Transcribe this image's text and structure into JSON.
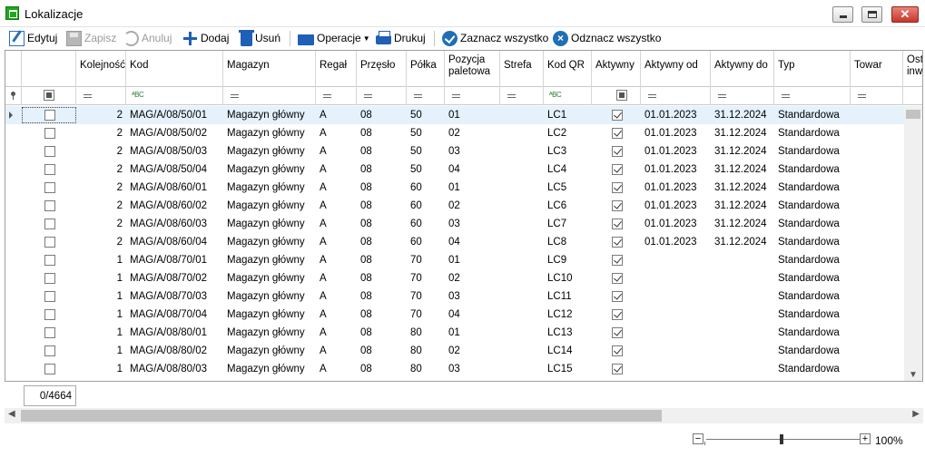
{
  "window": {
    "title": "Lokalizacje",
    "icon": "warehouse-app-icon",
    "close_glyph": "✕"
  },
  "toolbar": {
    "edit_label": "Edytuj",
    "save_label": "Zapisz",
    "cancel_label": "Anuluj",
    "add_label": "Dodaj",
    "delete_label": "Usuń",
    "operations_label": "Operacje",
    "print_label": "Drukuj",
    "select_all_label": "Zaznacz wszystko",
    "deselect_all_label": "Odznacz wszystko"
  },
  "columns": {
    "order": "Kolejność",
    "code": "Kod",
    "warehouse": "Magazyn",
    "rack": "Regał",
    "aisle": "Przęsło",
    "shelf": "Półka",
    "pallet_position": "Pozycja paletowa",
    "zone": "Strefa",
    "qr_code": "Kod QR",
    "active": "Aktywny",
    "active_from": "Aktywny od",
    "active_to": "Aktywny do",
    "type": "Typ",
    "item": "Towar",
    "last_inventory": "Ost. inw."
  },
  "rows": [
    {
      "order": "2",
      "code": "MAG/A/08/50/01",
      "warehouse": "Magazyn główny",
      "rack": "A",
      "aisle": "08",
      "shelf": "50",
      "pos": "01",
      "zone": "",
      "qr": "LC1",
      "active": true,
      "from": "01.01.2023",
      "to": "31.12.2024",
      "type": "Standardowa"
    },
    {
      "order": "2",
      "code": "MAG/A/08/50/02",
      "warehouse": "Magazyn główny",
      "rack": "A",
      "aisle": "08",
      "shelf": "50",
      "pos": "02",
      "zone": "",
      "qr": "LC2",
      "active": true,
      "from": "01.01.2023",
      "to": "31.12.2024",
      "type": "Standardowa"
    },
    {
      "order": "2",
      "code": "MAG/A/08/50/03",
      "warehouse": "Magazyn główny",
      "rack": "A",
      "aisle": "08",
      "shelf": "50",
      "pos": "03",
      "zone": "",
      "qr": "LC3",
      "active": true,
      "from": "01.01.2023",
      "to": "31.12.2024",
      "type": "Standardowa"
    },
    {
      "order": "2",
      "code": "MAG/A/08/50/04",
      "warehouse": "Magazyn główny",
      "rack": "A",
      "aisle": "08",
      "shelf": "50",
      "pos": "04",
      "zone": "",
      "qr": "LC4",
      "active": true,
      "from": "01.01.2023",
      "to": "31.12.2024",
      "type": "Standardowa"
    },
    {
      "order": "2",
      "code": "MAG/A/08/60/01",
      "warehouse": "Magazyn główny",
      "rack": "A",
      "aisle": "08",
      "shelf": "60",
      "pos": "01",
      "zone": "",
      "qr": "LC5",
      "active": true,
      "from": "01.01.2023",
      "to": "31.12.2024",
      "type": "Standardowa"
    },
    {
      "order": "2",
      "code": "MAG/A/08/60/02",
      "warehouse": "Magazyn główny",
      "rack": "A",
      "aisle": "08",
      "shelf": "60",
      "pos": "02",
      "zone": "",
      "qr": "LC6",
      "active": true,
      "from": "01.01.2023",
      "to": "31.12.2024",
      "type": "Standardowa"
    },
    {
      "order": "2",
      "code": "MAG/A/08/60/03",
      "warehouse": "Magazyn główny",
      "rack": "A",
      "aisle": "08",
      "shelf": "60",
      "pos": "03",
      "zone": "",
      "qr": "LC7",
      "active": true,
      "from": "01.01.2023",
      "to": "31.12.2024",
      "type": "Standardowa"
    },
    {
      "order": "2",
      "code": "MAG/A/08/60/04",
      "warehouse": "Magazyn główny",
      "rack": "A",
      "aisle": "08",
      "shelf": "60",
      "pos": "04",
      "zone": "",
      "qr": "LC8",
      "active": true,
      "from": "01.01.2023",
      "to": "31.12.2024",
      "type": "Standardowa"
    },
    {
      "order": "1",
      "code": "MAG/A/08/70/01",
      "warehouse": "Magazyn główny",
      "rack": "A",
      "aisle": "08",
      "shelf": "70",
      "pos": "01",
      "zone": "",
      "qr": "LC9",
      "active": true,
      "from": "",
      "to": "",
      "type": "Standardowa"
    },
    {
      "order": "1",
      "code": "MAG/A/08/70/02",
      "warehouse": "Magazyn główny",
      "rack": "A",
      "aisle": "08",
      "shelf": "70",
      "pos": "02",
      "zone": "",
      "qr": "LC10",
      "active": true,
      "from": "",
      "to": "",
      "type": "Standardowa"
    },
    {
      "order": "1",
      "code": "MAG/A/08/70/03",
      "warehouse": "Magazyn główny",
      "rack": "A",
      "aisle": "08",
      "shelf": "70",
      "pos": "03",
      "zone": "",
      "qr": "LC11",
      "active": true,
      "from": "",
      "to": "",
      "type": "Standardowa"
    },
    {
      "order": "1",
      "code": "MAG/A/08/70/04",
      "warehouse": "Magazyn główny",
      "rack": "A",
      "aisle": "08",
      "shelf": "70",
      "pos": "04",
      "zone": "",
      "qr": "LC12",
      "active": true,
      "from": "",
      "to": "",
      "type": "Standardowa"
    },
    {
      "order": "1",
      "code": "MAG/A/08/80/01",
      "warehouse": "Magazyn główny",
      "rack": "A",
      "aisle": "08",
      "shelf": "80",
      "pos": "01",
      "zone": "",
      "qr": "LC13",
      "active": true,
      "from": "",
      "to": "",
      "type": "Standardowa"
    },
    {
      "order": "1",
      "code": "MAG/A/08/80/02",
      "warehouse": "Magazyn główny",
      "rack": "A",
      "aisle": "08",
      "shelf": "80",
      "pos": "02",
      "zone": "",
      "qr": "LC14",
      "active": true,
      "from": "",
      "to": "",
      "type": "Standardowa"
    },
    {
      "order": "1",
      "code": "MAG/A/08/80/03",
      "warehouse": "Magazyn główny",
      "rack": "A",
      "aisle": "08",
      "shelf": "80",
      "pos": "03",
      "zone": "",
      "qr": "LC15",
      "active": true,
      "from": "",
      "to": "",
      "type": "Standardowa"
    }
  ],
  "selected_row_index": 0,
  "footer": {
    "selection_count": "0/4664"
  },
  "zoom": {
    "level_label": "100%",
    "level": 1.0,
    "minus": "−",
    "plus": "+"
  },
  "colors": {
    "selected_row": "#e5f1fb",
    "accent": "#1f5fb5"
  }
}
